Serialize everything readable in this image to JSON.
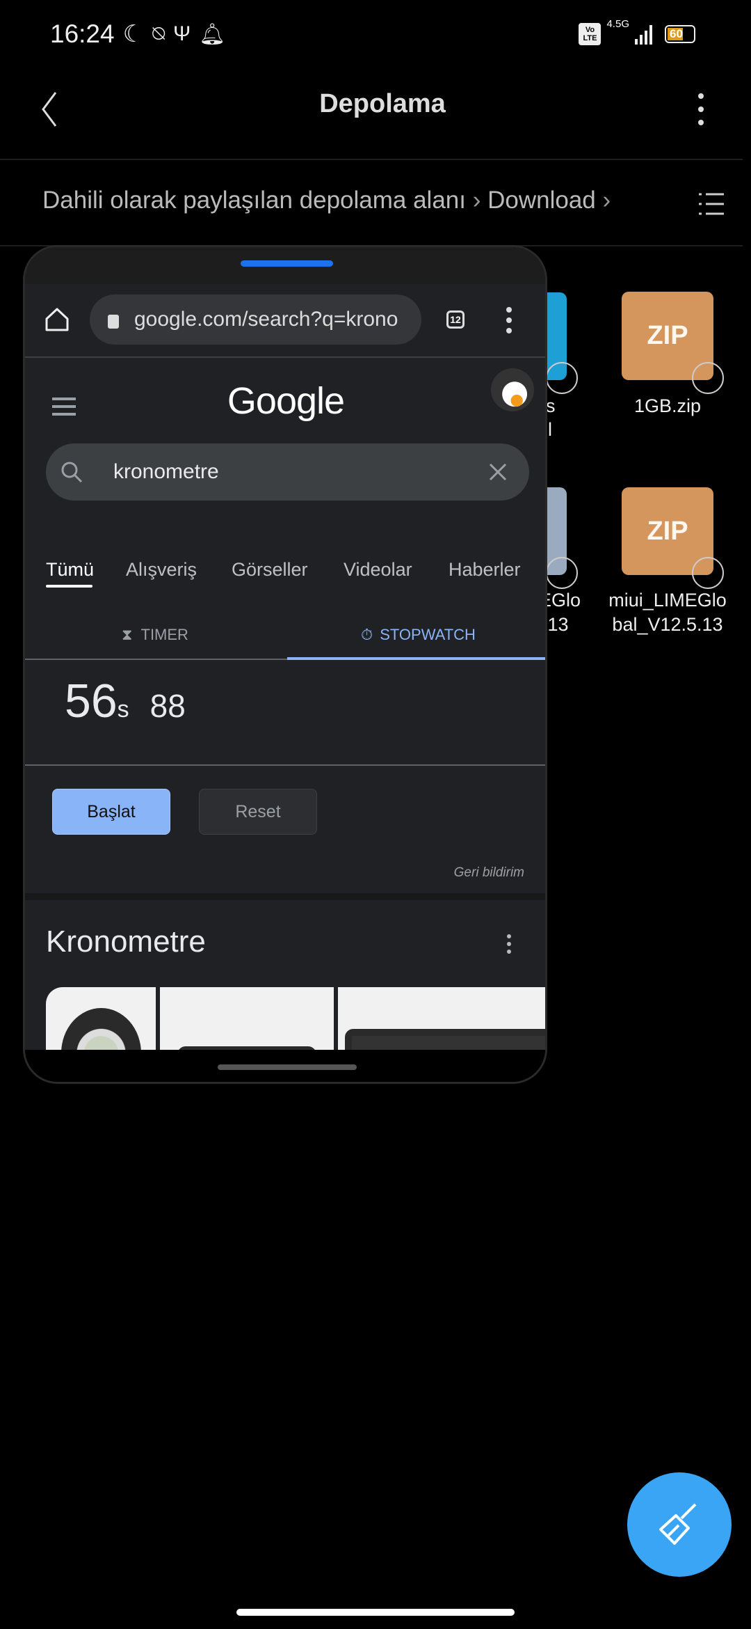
{
  "status_bar": {
    "time": "16:24",
    "network": "4.5G",
    "volte": "Vo LTE",
    "battery": "60",
    "icons": [
      "moon-icon",
      "vibrate-off-icon",
      "usb-icon",
      "bell-icon"
    ]
  },
  "header": {
    "title": "Depolama",
    "back_icon": "chevron-left-icon",
    "more_icon": "more-vertical-icon"
  },
  "breadcrumb": {
    "items": [
      "Dahili olarak paylaşılan depolama alanı",
      "Download"
    ],
    "view_icon": "list-view-icon"
  },
  "files": [
    {
      "label_partial": [
        "s",
        "l"
      ],
      "color": "#1e9fd6"
    },
    {
      "label": "1GB.zip",
      "badge": "ZIP",
      "color": "#d4965c"
    },
    {
      "label_partial": [
        "EGlo",
        ".13"
      ],
      "color": "#9aabbf"
    },
    {
      "label_lines": [
        "miui_LIMEGlo",
        "bal_V12.5.13"
      ],
      "badge": "ZIP",
      "color": "#d4965c"
    }
  ],
  "floating_window": {
    "browser": {
      "url": "google.com/search?q=krono",
      "tab_count": "12"
    },
    "google": {
      "logo": "Google",
      "query": "kronometre",
      "tabs": [
        {
          "label": "Tümü",
          "active": true
        },
        {
          "label": "Alışveriş"
        },
        {
          "label": "Görseller"
        },
        {
          "label": "Videolar"
        },
        {
          "label": "Haberler"
        }
      ],
      "widget_tabs": [
        {
          "label": "TIMER",
          "icon": "hourglass-icon"
        },
        {
          "label": "STOPWATCH",
          "icon": "stopwatch-icon",
          "active": true
        }
      ],
      "stopwatch": {
        "seconds": "56",
        "unit": "s",
        "hundredths": "88"
      },
      "start_label": "Başlat",
      "reset_label": "Reset",
      "feedback": "Geri bildirim",
      "section_title": "Kronometre"
    },
    "accent": "#8ab4f8"
  },
  "fab": {
    "icon": "broom-clean-icon",
    "color": "#3aa5f5"
  }
}
